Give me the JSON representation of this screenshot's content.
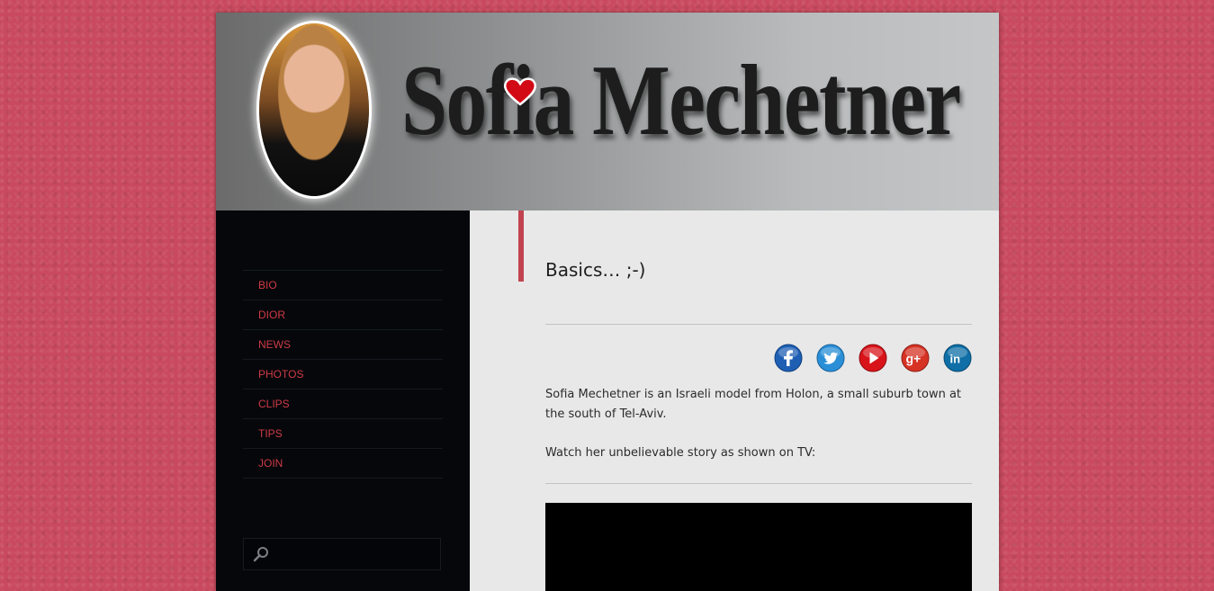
{
  "header": {
    "site_title": "Sofia Mechetner",
    "avatar_label": "portrait-photo",
    "heart_icon": "heart-icon",
    "heart_color": "#d10a16"
  },
  "nav": {
    "items": [
      {
        "label": "BIO"
      },
      {
        "label": "DIOR"
      },
      {
        "label": "NEWS"
      },
      {
        "label": "PHOTOS"
      },
      {
        "label": "CLIPS"
      },
      {
        "label": "TIPS"
      },
      {
        "label": "JOIN"
      }
    ],
    "link_color": "#cf3b45"
  },
  "search": {
    "placeholder": "",
    "icon": "search-icon"
  },
  "post": {
    "title": "Basics… ;-)",
    "intro": "Sofia Mechetner is an Israeli model from Holon, a small suburb town at the south of Tel-Aviv.",
    "watch": "Watch her unbelievable story as shown on TV:",
    "accent_color": "#c1434f"
  },
  "social": [
    {
      "name": "facebook",
      "icon": "facebook-icon",
      "glyph": "f",
      "color": "#1f5fb3"
    },
    {
      "name": "twitter",
      "icon": "twitter-icon",
      "glyph": "",
      "color": "#2a8fd6"
    },
    {
      "name": "youtube",
      "icon": "youtube-icon",
      "glyph": "",
      "color": "#d8141a"
    },
    {
      "name": "google-plus",
      "icon": "google-plus-icon",
      "glyph": "g+",
      "color": "#d63325"
    },
    {
      "name": "linkedin",
      "icon": "linkedin-icon",
      "glyph": "in",
      "color": "#0f6fa6"
    }
  ]
}
